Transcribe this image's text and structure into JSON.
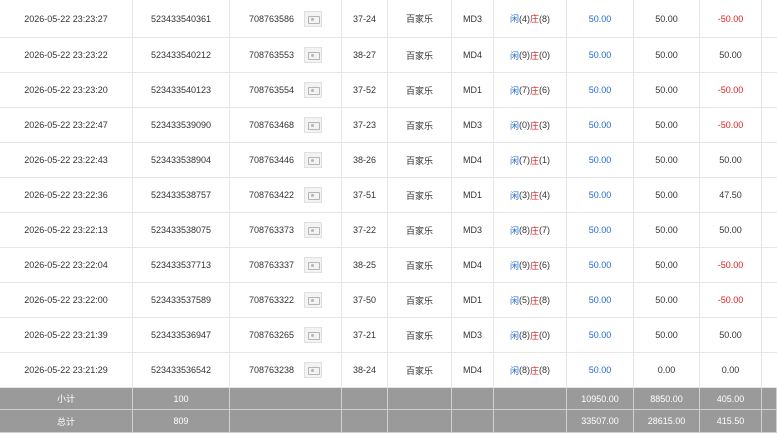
{
  "rows": [
    {
      "time": "2026-05-22 23:23:27",
      "bet_id": "523433540361",
      "round_id": "708763586",
      "table": "37-24",
      "game": "百家乐",
      "room": "MD3",
      "player_label": "闲",
      "player_score": "(4)",
      "banker_label": "庄",
      "banker_score": "(8)",
      "bet": "50.00",
      "valid": "50.00",
      "win": "-50.00",
      "win_negative": true
    },
    {
      "time": "2026-05-22 23:23:22",
      "bet_id": "523433540212",
      "round_id": "708763553",
      "table": "38-27",
      "game": "百家乐",
      "room": "MD4",
      "player_label": "闲",
      "player_score": "(9)",
      "banker_label": "庄",
      "banker_score": "(0)",
      "bet": "50.00",
      "valid": "50.00",
      "win": "50.00",
      "win_negative": false
    },
    {
      "time": "2026-05-22 23:23:20",
      "bet_id": "523433540123",
      "round_id": "708763554",
      "table": "37-52",
      "game": "百家乐",
      "room": "MD1",
      "player_label": "闲",
      "player_score": "(7)",
      "banker_label": "庄",
      "banker_score": "(6)",
      "bet": "50.00",
      "valid": "50.00",
      "win": "-50.00",
      "win_negative": true
    },
    {
      "time": "2026-05-22 23:22:47",
      "bet_id": "523433539090",
      "round_id": "708763468",
      "table": "37-23",
      "game": "百家乐",
      "room": "MD3",
      "player_label": "闲",
      "player_score": "(0)",
      "banker_label": "庄",
      "banker_score": "(3)",
      "bet": "50.00",
      "valid": "50.00",
      "win": "-50.00",
      "win_negative": true
    },
    {
      "time": "2026-05-22 23:22:43",
      "bet_id": "523433538904",
      "round_id": "708763446",
      "table": "38-26",
      "game": "百家乐",
      "room": "MD4",
      "player_label": "闲",
      "player_score": "(7)",
      "banker_label": "庄",
      "banker_score": "(1)",
      "bet": "50.00",
      "valid": "50.00",
      "win": "50.00",
      "win_negative": false
    },
    {
      "time": "2026-05-22 23:22:36",
      "bet_id": "523433538757",
      "round_id": "708763422",
      "table": "37-51",
      "game": "百家乐",
      "room": "MD1",
      "player_label": "闲",
      "player_score": "(3)",
      "banker_label": "庄",
      "banker_score": "(4)",
      "bet": "50.00",
      "valid": "50.00",
      "win": "47.50",
      "win_negative": false
    },
    {
      "time": "2026-05-22 23:22:13",
      "bet_id": "523433538075",
      "round_id": "708763373",
      "table": "37-22",
      "game": "百家乐",
      "room": "MD3",
      "player_label": "闲",
      "player_score": "(8)",
      "banker_label": "庄",
      "banker_score": "(7)",
      "bet": "50.00",
      "valid": "50.00",
      "win": "50.00",
      "win_negative": false
    },
    {
      "time": "2026-05-22 23:22:04",
      "bet_id": "523433537713",
      "round_id": "708763337",
      "table": "38-25",
      "game": "百家乐",
      "room": "MD4",
      "player_label": "闲",
      "player_score": "(9)",
      "banker_label": "庄",
      "banker_score": "(6)",
      "bet": "50.00",
      "valid": "50.00",
      "win": "-50.00",
      "win_negative": true
    },
    {
      "time": "2026-05-22 23:22:00",
      "bet_id": "523433537589",
      "round_id": "708763322",
      "table": "37-50",
      "game": "百家乐",
      "room": "MD1",
      "player_label": "闲",
      "player_score": "(5)",
      "banker_label": "庄",
      "banker_score": "(8)",
      "bet": "50.00",
      "valid": "50.00",
      "win": "-50.00",
      "win_negative": true
    },
    {
      "time": "2026-05-22 23:21:39",
      "bet_id": "523433536947",
      "round_id": "708763265",
      "table": "37-21",
      "game": "百家乐",
      "room": "MD3",
      "player_label": "闲",
      "player_score": "(8)",
      "banker_label": "庄",
      "banker_score": "(0)",
      "bet": "50.00",
      "valid": "50.00",
      "win": "50.00",
      "win_negative": false
    },
    {
      "time": "2026-05-22 23:21:29",
      "bet_id": "523433536542",
      "round_id": "708763238",
      "table": "38-24",
      "game": "百家乐",
      "room": "MD4",
      "player_label": "闲",
      "player_score": "(8)",
      "banker_label": "庄",
      "banker_score": "(8)",
      "bet": "50.00",
      "valid": "0.00",
      "win": "0.00",
      "win_negative": false
    }
  ],
  "subtotal": {
    "label": "小计",
    "count": "100",
    "bet": "10950.00",
    "valid": "8850.00",
    "win": "405.00"
  },
  "total": {
    "label": "总计",
    "count": "809",
    "bet": "33507.00",
    "valid": "28615.00",
    "win": "415.50"
  },
  "icons": {
    "thumbnail": "image-thumbnail-icon"
  },
  "colors": {
    "player_blue": "#1e6ad1",
    "negative_red": "#e02020",
    "summary_bg": "#9a9a9a"
  }
}
